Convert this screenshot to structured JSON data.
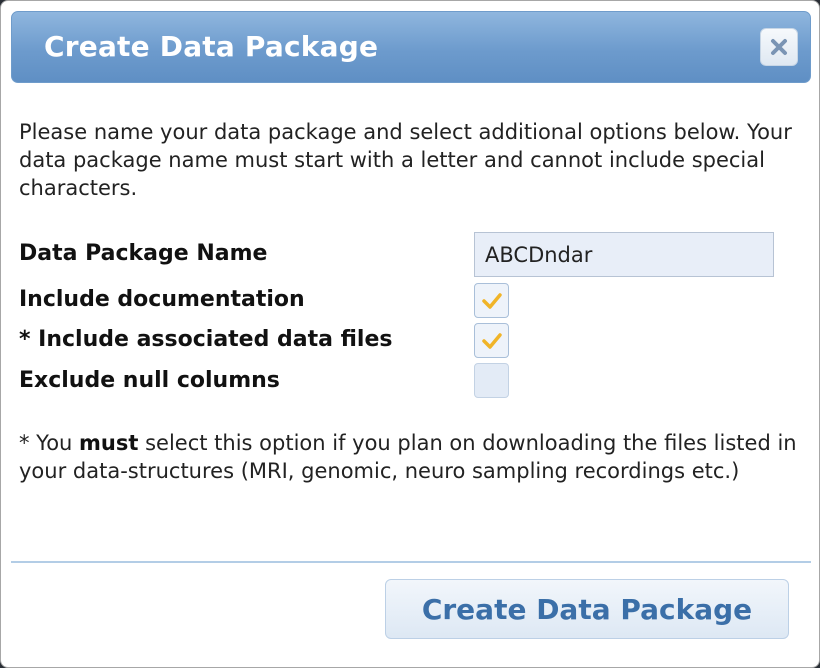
{
  "dialog": {
    "title": "Create Data Package",
    "close_icon": "close-icon"
  },
  "intro_text": "Please name your data package and select additional options below. Your data package name must start with a letter and cannot include special characters.",
  "form": {
    "name_label": "Data Package Name",
    "name_value": "ABCDndar",
    "options": [
      {
        "label": "Include documentation",
        "checked": true
      },
      {
        "label": "* Include associated data files",
        "checked": true
      },
      {
        "label": "Exclude null columns",
        "checked": false
      }
    ]
  },
  "note": {
    "prefix": "* You ",
    "emphasis": "must",
    "suffix": " select this option if you plan on downloading the files listed in your data-structures (MRI, genomic, neuro sampling recordings etc.)"
  },
  "footer": {
    "submit_label": "Create Data Package"
  },
  "colors": {
    "title_bar": "#6d9bcd",
    "check_mark": "#f0b428",
    "button_text": "#3b6fa8"
  }
}
